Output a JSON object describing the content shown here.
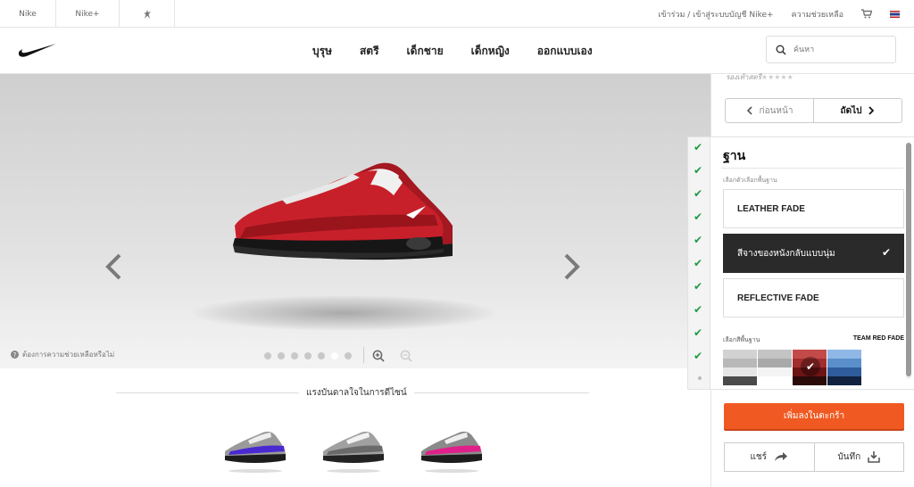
{
  "topbar": {
    "brand_nike": "Nike",
    "brand_nikeplus": "Nike+",
    "login": "เข้าร่วม / เข้าสู่ระบบบัญชี Nike+",
    "help": "ความช่วยเหลือ",
    "icons": [
      "jordan-jumpman-icon",
      "cart-icon",
      "thai-flag-icon"
    ]
  },
  "nav": {
    "links": [
      "บุรุษ",
      "สตรี",
      "เด็กชาย",
      "เด็กหญิง",
      "ออกแบบเอง"
    ],
    "search_placeholder": "ค้นหา"
  },
  "stage": {
    "help_text": "ต้องการความช่วยเหลือหรือไม่",
    "dot_count": 7,
    "active_dot": 6,
    "inspiration_title": "แรงบันดาลใจในการดีไซน์",
    "thumbnail_accents": [
      "#4a2ad0",
      "#222222",
      "#e0208a"
    ]
  },
  "panel": {
    "rating_label": "รองเท้าสตรี",
    "stars": "★★★★★",
    "prev_label": "ก่อนหน้า",
    "next_label": "ถัดไป",
    "section_title": "ฐาน",
    "option_header": "เลือกตัวเลือกพื้นฐาน",
    "options": [
      "LEATHER FADE",
      "สีจางของหนังกลับแบบนุ่ม",
      "REFLECTIVE FADE"
    ],
    "selected_option": 1,
    "color_header": "เลือกสีพื้นฐาน",
    "color_value": "TEAM RED FADE",
    "swatches": [
      {
        "colors": [
          "#d2d2d2",
          "#b8b8b8",
          "#8e8e8e",
          "#4a4a4a"
        ]
      },
      {
        "colors": [
          "#c4c4c4",
          "#b0b0b0",
          "#f4f4f4",
          "#ffffff"
        ]
      },
      {
        "colors": [
          "#c44a4a",
          "#a22d2d",
          "#6d1414",
          "#2b0a0a"
        ]
      },
      {
        "colors": [
          "#8fb8e6",
          "#5a8fcc",
          "#2f5c9c",
          "#10223f"
        ]
      }
    ],
    "selected_swatch": 2,
    "add_to_cart": "เพิ่มลงในตะกร้า",
    "share_label": "แชร์",
    "save_label": "บันทึก"
  },
  "colors": {
    "accent_orange": "#f05a22",
    "check_green": "#1e9a45",
    "shoe_red": "#c8202a"
  }
}
